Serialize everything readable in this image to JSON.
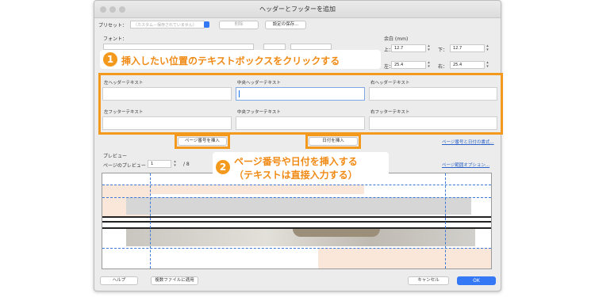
{
  "dialog": {
    "title": "ヘッダーとフッターを追加"
  },
  "preset": {
    "label": "プリセット：",
    "value": "（カスタム－保存されていません）",
    "delete_button": "削除",
    "save_button": "設定の保存..."
  },
  "font_label": "フォント：",
  "margins": {
    "title": "余白 (mm)",
    "top_label": "上：",
    "top_value": "12.7",
    "bottom_label": "下：",
    "bottom_value": "12.7",
    "left_label": "左：",
    "left_value": "25.4",
    "right_label": "右：",
    "right_value": "25.4"
  },
  "fields": {
    "left_header": "左ヘッダーテキスト",
    "center_header": "中央ヘッダーテキスト",
    "right_header": "右ヘッダーテキスト",
    "left_footer": "左フッターテキスト",
    "center_footer": "中央フッターテキスト",
    "right_footer": "右フッターテキスト"
  },
  "buttons": {
    "insert_page_number": "ページ番号を挿入",
    "insert_date": "日付を挿入",
    "help": "ヘルプ",
    "apply_multiple": "複数ファイルに適用",
    "cancel": "キャンセル",
    "ok": "OK"
  },
  "links": {
    "page_date_format": "ページ番号と日付の書式...",
    "page_range_options": "ページ範囲オプション..."
  },
  "preview": {
    "label": "プレビュー",
    "page_label": "ページのプレビュー",
    "page_value": "1",
    "page_total": "/ 8"
  },
  "callouts": {
    "step1_number": "1",
    "step1_text": "挿入したい位置のテキストボックスをクリックする",
    "step2_number": "2",
    "step2_line1": "ページ番号や日付を挿入する",
    "step2_line2": "（テキストは直接入力する）"
  },
  "colors": {
    "accent_orange": "#f39a1e",
    "callout_text": "#f08a14",
    "primary_blue": "#3478f6",
    "guide_blue": "#3c78d8",
    "page_tint": "#fbe6da"
  }
}
